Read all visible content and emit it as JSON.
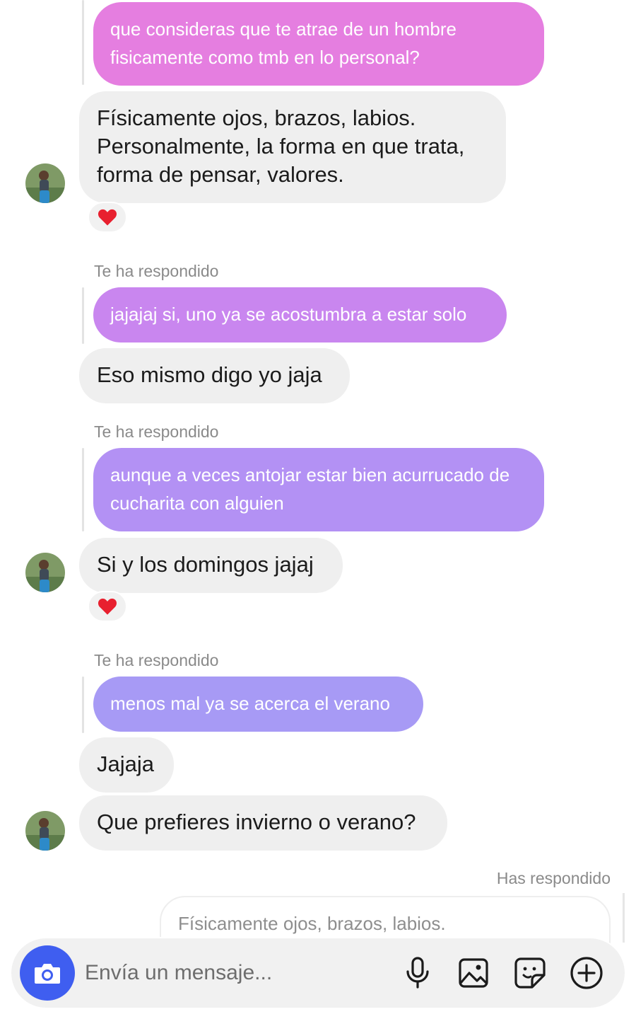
{
  "colors": {
    "reply_bubble_1": "#e57ee0",
    "reply_bubble_2": "#c986ef",
    "reply_bubble_3": "#b391f4",
    "reply_bubble_4": "#a79af5",
    "incoming_bubble": "#efefef",
    "camera_button": "#3f5ef0"
  },
  "messages": {
    "reply1": "que consideras que te atrae de un hombre fisicamente como tmb en lo personal?",
    "in1": "Físicamente ojos, brazos, labios. Personalmente, la forma en que trata, forma de pensar, valores.",
    "reaction1": "❤️",
    "label2": "Te ha respondido",
    "reply2": "jajajaj si, uno ya se acostumbra a estar solo",
    "in2": "Eso mismo digo yo jaja",
    "label3": "Te ha respondido",
    "reply3": "aunque a veces antojar estar bien acurrucado de cucharita con alguien",
    "in3": "Si y los domingos jajaj",
    "reaction3": "❤️",
    "label4": "Te ha respondido",
    "reply4": "menos mal ya se acerca el verano",
    "in4a": "Jajaja",
    "in4b": "Que prefieres invierno o verano?",
    "outgoing_label": "Has respondido",
    "quoted": "Físicamente ojos, brazos, labios."
  },
  "composer": {
    "placeholder": "Envía un mensaje...",
    "camera_icon": "camera-icon",
    "mic_icon": "microphone-icon",
    "gallery_icon": "image-icon",
    "sticker_icon": "sticker-icon",
    "more_icon": "plus-circle-icon"
  }
}
